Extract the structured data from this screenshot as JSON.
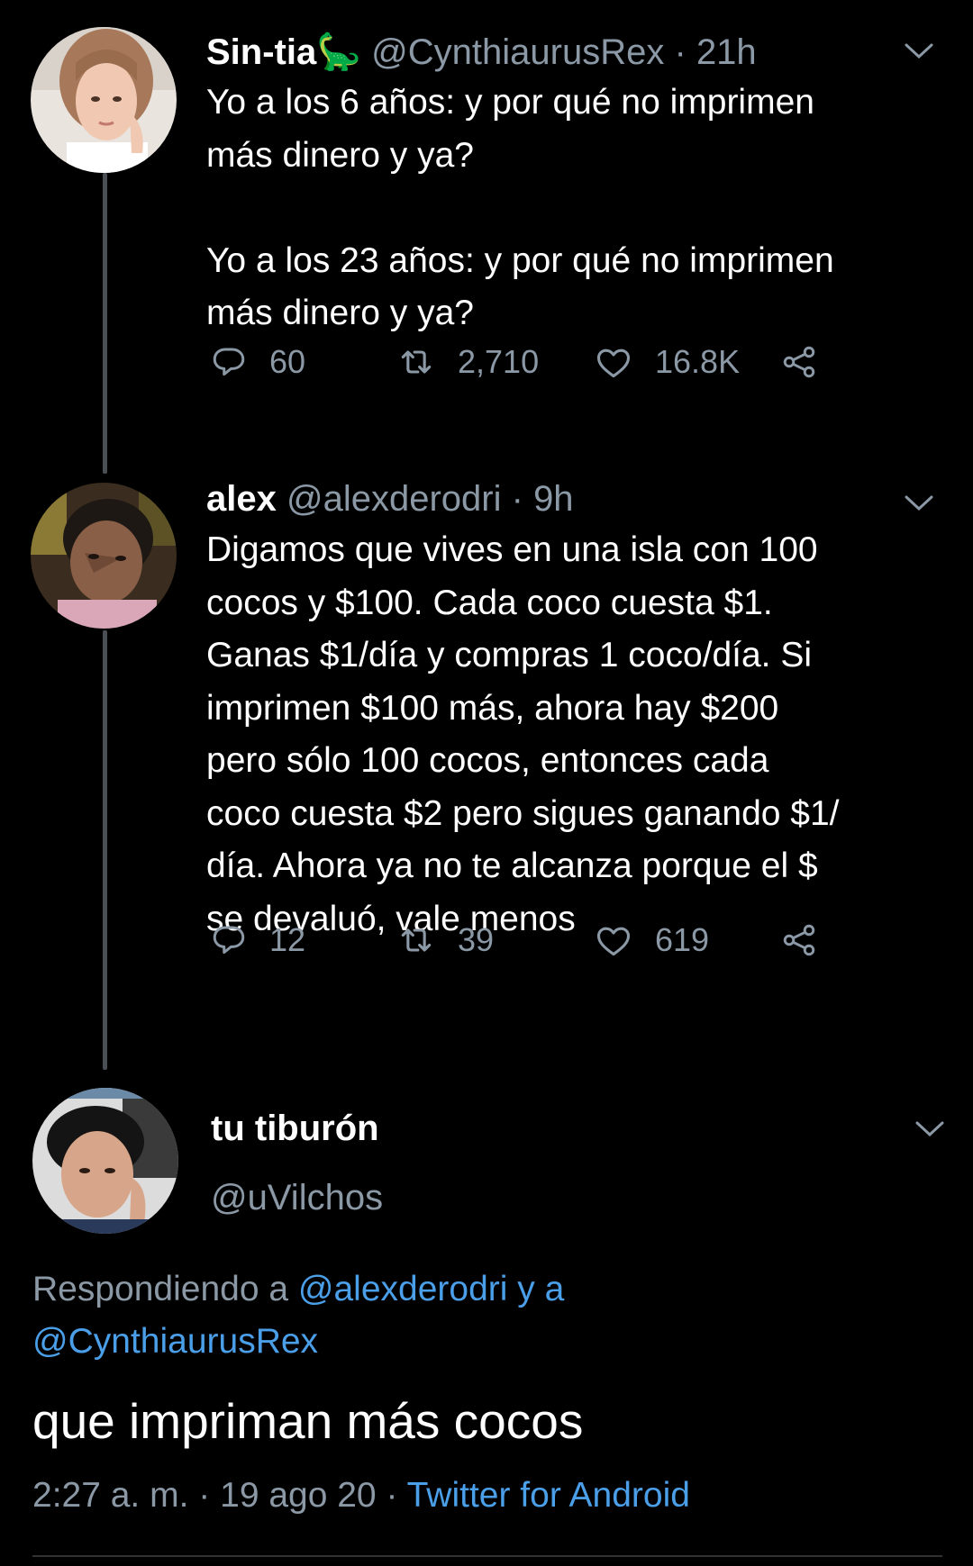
{
  "thread": [
    {
      "name": "Sin-tia",
      "name_emoji": "🦕",
      "handle": "@CynthiaurusRex",
      "separator": "·",
      "time": "21h",
      "text": "Yo a los 6 años: y por qué no imprimen\nmás dinero y ya?\n\nYo a los 23 años: y por qué no imprimen\nmás dinero y ya?",
      "replies": "60",
      "retweets": "2,710",
      "likes": "16.8K"
    },
    {
      "name": "alex",
      "handle": "@alexderodri",
      "separator": "·",
      "time": "9h",
      "text": "Digamos que vives en una isla con 100\ncocos y $100. Cada coco cuesta $1.\nGanas $1/día y compras 1 coco/día. Si\nimprimen $100 más, ahora hay $200\npero sólo 100 cocos, entonces cada\ncoco cuesta $2 pero sigues ganando $1/\ndía. Ahora ya no te alcanza porque el $\nse devaluó, vale menos",
      "replies": "12",
      "retweets": "39",
      "likes": "619"
    }
  ],
  "main": {
    "name": "tu tiburón",
    "handle": "@uVilchos",
    "replying_prefix": "Respondiendo a ",
    "replying_user1": "@alexderodri",
    "replying_mid": " y a",
    "replying_user2": "@CynthiaurusRex",
    "text": "que impriman más cocos",
    "time": "2:27 a. m.",
    "date": "19 ago 20",
    "separator": "·",
    "client": "Twitter for Android"
  },
  "colors": {
    "background": "#000000",
    "secondary_text": "#8b98a5",
    "link": "#4a9fe8",
    "thread_line": "#4a4f55"
  },
  "icons": [
    "reply-icon",
    "retweet-icon",
    "like-icon",
    "share-icon",
    "chevron-down-icon"
  ]
}
